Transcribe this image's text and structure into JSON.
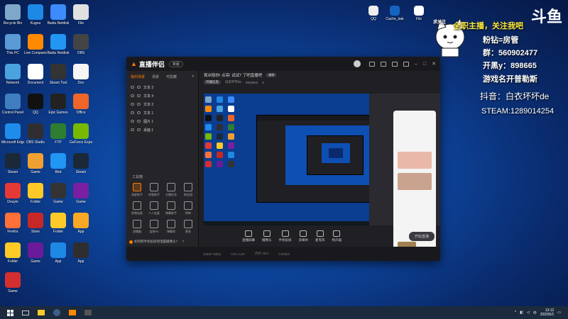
{
  "desktop": {
    "left_icons": [
      {
        "label": "Recycle Bin",
        "color": "#7fa7c9"
      },
      {
        "label": "Kugou",
        "color": "#1e88e5"
      },
      {
        "label": "Baidu Netdisk",
        "color": "#3d8bfd"
      },
      {
        "label": "File",
        "color": "#e0e0e0"
      },
      {
        "label": "This PC",
        "color": "#5a9bd5"
      },
      {
        "label": "Live Companion",
        "color": "#ff8a00"
      },
      {
        "label": "Baidu Netdisk",
        "color": "#2196f3"
      },
      {
        "label": "OBS",
        "color": "#444444"
      },
      {
        "label": "Network",
        "color": "#4aa3df"
      },
      {
        "label": "Document",
        "color": "#ffffff"
      },
      {
        "label": "Steam Tool",
        "color": "#333333"
      },
      {
        "label": "Doc",
        "color": "#f5f5f5"
      },
      {
        "label": "Control Panel",
        "color": "#3f7fbf"
      },
      {
        "label": "QQ",
        "color": "#111111"
      },
      {
        "label": "Epic Games",
        "color": "#222222"
      },
      {
        "label": "Office",
        "color": "#f06529"
      },
      {
        "label": "Microsoft Edge",
        "color": "#1f8ceb"
      },
      {
        "label": "OBS Studio",
        "color": "#302e31"
      },
      {
        "label": "FTP",
        "color": "#2e7d32"
      },
      {
        "label": "GeForce Experience",
        "color": "#76b900"
      },
      {
        "label": "Steam",
        "color": "#1b2838"
      },
      {
        "label": "Game",
        "color": "#f0a030"
      },
      {
        "label": "Bird",
        "color": "#2196f3"
      },
      {
        "label": "Steam",
        "color": "#1b2838"
      },
      {
        "label": "Douyin",
        "color": "#e53935"
      },
      {
        "label": "Folder",
        "color": "#ffca28"
      },
      {
        "label": "Game",
        "color": "#333333"
      },
      {
        "label": "Game",
        "color": "#7b1fa2"
      },
      {
        "label": "Firefox",
        "color": "#ff7139"
      },
      {
        "label": "Store",
        "color": "#c62828"
      },
      {
        "label": "Folder",
        "color": "#ffca28"
      },
      {
        "label": "App",
        "color": "#f9a825"
      },
      {
        "label": "Folder",
        "color": "#ffca28"
      },
      {
        "label": "Game",
        "color": "#6a1b9a"
      },
      {
        "label": "App",
        "color": "#1e88e5"
      },
      {
        "label": "App",
        "color": "#2e2e2e"
      },
      {
        "label": "Game",
        "color": "#d32f2f"
      }
    ],
    "top_right_icons": [
      {
        "label": "QQ",
        "color": "#eeeeee"
      },
      {
        "label": "Cache_bak",
        "color": "#1565c0"
      },
      {
        "label": "File",
        "color": "#ffffff"
      }
    ]
  },
  "overlay": {
    "slogan": "全职主播，关注我吧",
    "line1": "粉钻=房管",
    "line2": "群：560902477",
    "line3": "开黑y：898665",
    "line4": "游戏名开普勒斯",
    "line5": "抖音：白衣坏坏de",
    "line6": "STEAM:1289014254",
    "logo": "斗鱼",
    "mascot_tag": "求关注"
  },
  "app": {
    "title": "直播伴侣",
    "version": "新版",
    "sidebar_tabs": [
      "我的场景",
      "场景",
      "可隐藏"
    ],
    "scenes": [
      "文本 3",
      "文本 4",
      "文本 2",
      "文本 1",
      "图片 1",
      "桌面 1"
    ],
    "tools_title": "工具箱",
    "tools": [
      "录屏助手",
      "房管助手",
      "主播任务",
      "粉丝团",
      "视频连麦",
      "人人连麦",
      "弹幕助手",
      "榜单",
      "录播器",
      "连线PK",
      "弹幕库",
      "更多"
    ],
    "notice": "如何把手机投屏到电脑摄像头?",
    "room_title": "观众陪你! 点亮! 试试? 了吧直播吧",
    "room_tag": "编辑",
    "info_button": "开播信息",
    "info_items": [
      "白衣坏坏de",
      "5929842",
      "0"
    ],
    "bottom_tools": [
      "直播屏幕",
      "摄像头",
      "手机投屏",
      "多媒体",
      "麦克风",
      "扬声器"
    ],
    "start_button": "开始直播",
    "status_items": [
      "1080P 60fps",
      "CPU 12%",
      "内存 45%",
      "0.0KB/s"
    ]
  },
  "taskbar": {
    "time": "13:12",
    "date": "2022/6/1"
  }
}
